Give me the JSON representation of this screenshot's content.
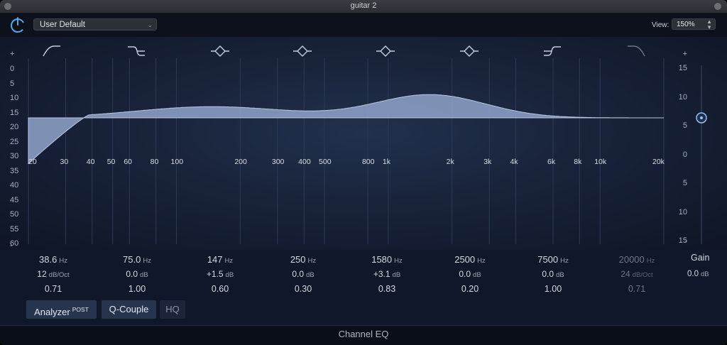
{
  "window": {
    "title": "guitar 2"
  },
  "toolbar": {
    "preset": "User Default",
    "view_label": "View:",
    "view_value": "150%",
    "power_icon": "power-icon"
  },
  "scale_left": {
    "plus": "+",
    "minus": "-",
    "labels": [
      "0",
      "5",
      "10",
      "15",
      "20",
      "25",
      "30",
      "35",
      "40",
      "45",
      "50",
      "55",
      "60"
    ]
  },
  "scale_right": {
    "plus": "+",
    "minus": "-",
    "labels": [
      "15",
      "10",
      "5",
      "0",
      "5",
      "10",
      "15"
    ]
  },
  "freq_axis": [
    "20",
    "30",
    "40",
    "50",
    "60",
    "80",
    "100",
    "200",
    "300",
    "400",
    "500",
    "800",
    "1k",
    "2k",
    "3k",
    "4k",
    "6k",
    "8k",
    "10k",
    "20k"
  ],
  "bands": [
    {
      "type": "low-cut",
      "freq": "38.6",
      "freq_unit": "Hz",
      "gain": "12",
      "gain_unit": "dB/Oct",
      "q": "0.71",
      "enabled": true
    },
    {
      "type": "low-shelf",
      "freq": "75.0",
      "freq_unit": "Hz",
      "gain": "0.0",
      "gain_unit": "dB",
      "q": "1.00",
      "enabled": true
    },
    {
      "type": "bell",
      "freq": "147",
      "freq_unit": "Hz",
      "gain": "+1.5",
      "gain_unit": "dB",
      "q": "0.60",
      "enabled": true
    },
    {
      "type": "bell",
      "freq": "250",
      "freq_unit": "Hz",
      "gain": "0.0",
      "gain_unit": "dB",
      "q": "0.30",
      "enabled": true
    },
    {
      "type": "bell",
      "freq": "1580",
      "freq_unit": "Hz",
      "gain": "+3.1",
      "gain_unit": "dB",
      "q": "0.83",
      "enabled": true
    },
    {
      "type": "bell",
      "freq": "2500",
      "freq_unit": "Hz",
      "gain": "0.0",
      "gain_unit": "dB",
      "q": "0.20",
      "enabled": true
    },
    {
      "type": "high-shelf",
      "freq": "7500",
      "freq_unit": "Hz",
      "gain": "0.0",
      "gain_unit": "dB",
      "q": "1.00",
      "enabled": true
    },
    {
      "type": "high-cut",
      "freq": "20000",
      "freq_unit": "Hz",
      "gain": "24",
      "gain_unit": "dB/Oct",
      "q": "0.71",
      "enabled": false
    }
  ],
  "gain": {
    "label": "Gain",
    "value": "0.0",
    "unit": "dB"
  },
  "buttons": {
    "analyzer": "Analyzer",
    "analyzer_sup": "POST",
    "q_couple": "Q-Couple",
    "hq": "HQ"
  },
  "footer": {
    "title": "Channel EQ"
  },
  "colors": {
    "curve_fill": "#8a9cc2",
    "accent": "#8fb0e8",
    "background": "#162036"
  }
}
